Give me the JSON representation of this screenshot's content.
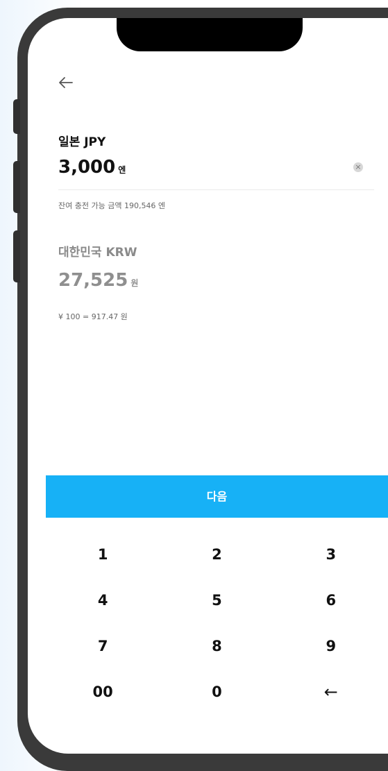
{
  "header": {
    "back_icon": "arrow-left-icon"
  },
  "from": {
    "label": "일본 JPY",
    "amount": "3,000",
    "unit": "엔",
    "clear_icon": "clear-circle-icon",
    "clear_symbol": "×",
    "balance_note": "잔여 충전 가능 금액 190,546 엔"
  },
  "to": {
    "label": "대한민국 KRW",
    "amount": "27,525",
    "unit": "원",
    "rate": "¥ 100 = 917.47 원"
  },
  "next_label": "다음",
  "keypad": {
    "rows": [
      [
        "1",
        "2",
        "3"
      ],
      [
        "4",
        "5",
        "6"
      ],
      [
        "7",
        "8",
        "9"
      ],
      [
        "00",
        "0",
        "←"
      ]
    ]
  },
  "colors": {
    "accent": "#17b1f6",
    "frame": "#3a3a3a",
    "muted": "#8f8f8f"
  }
}
